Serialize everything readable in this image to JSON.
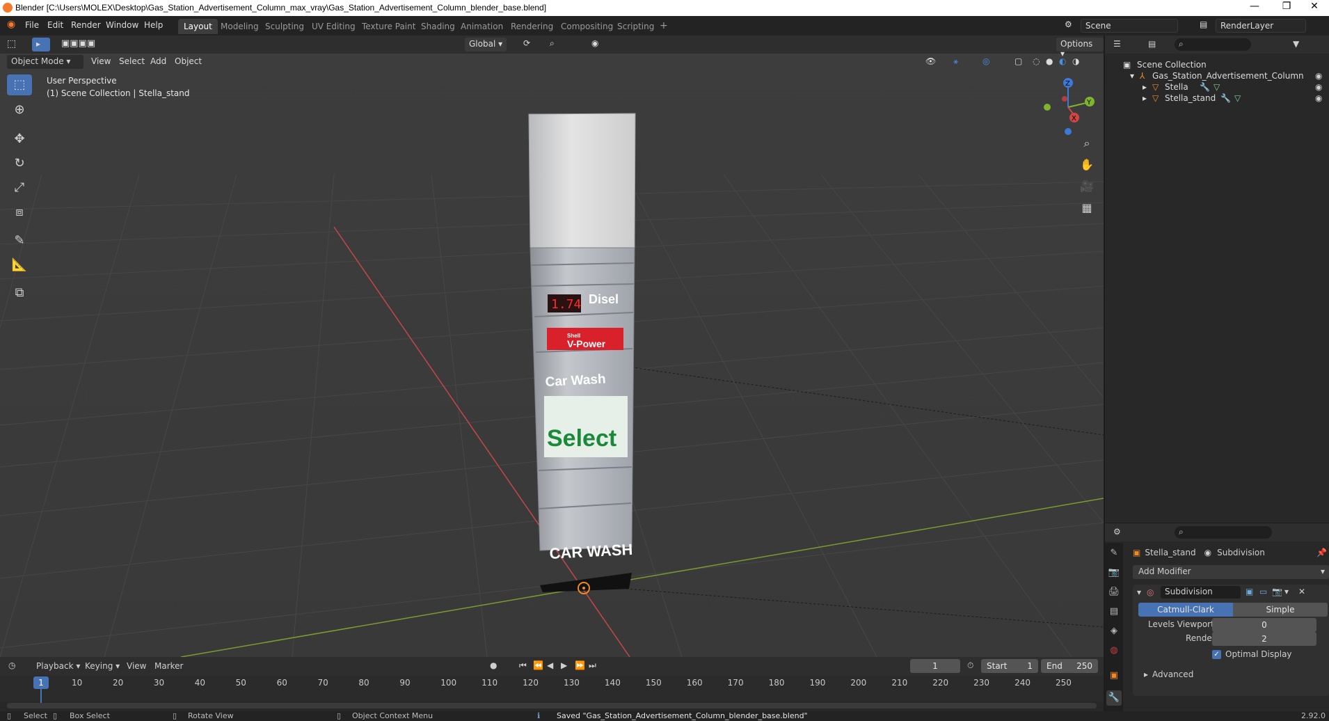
{
  "window": {
    "title": "Blender [C:\\Users\\MOLEX\\Desktop\\Gas_Station_Advertisement_Column_max_vray\\Gas_Station_Advertisement_Column_blender_base.blend]",
    "minimize": "—",
    "restore": "❐",
    "close": "✕"
  },
  "menu": [
    "File",
    "Edit",
    "Render",
    "Window",
    "Help"
  ],
  "workspaces": [
    "Layout",
    "Modeling",
    "Sculpting",
    "UV Editing",
    "Texture Paint",
    "Shading",
    "Animation",
    "Rendering",
    "Compositing",
    "Scripting"
  ],
  "active_workspace": "Layout",
  "scene": {
    "name": "Scene",
    "view_layer": "RenderLayer"
  },
  "viewport": {
    "transform_orientation": "Global",
    "options_label": "Options",
    "mode": "Object Mode",
    "header_menus": [
      "View",
      "Select",
      "Add",
      "Object"
    ],
    "info_line1": "User Perspective",
    "info_line2": "(1) Scene Collection | Stella_stand",
    "tools": [
      "select-box-icon",
      "cursor-icon",
      "move-icon",
      "rotate-icon",
      "scale-icon",
      "transform-icon",
      "annotate-icon",
      "measure-icon",
      "add-cube-icon"
    ],
    "gizmo_axes": {
      "z": "Z",
      "y": "Y",
      "x": "X"
    },
    "model_labels": {
      "price": "1.74",
      "fuel": "Disel",
      "brand_small": "Shell",
      "brand": "V-Power",
      "carwash1": "Car Wash",
      "select": "Select",
      "carwash2": "CAR WASH"
    }
  },
  "outliner": {
    "root": "Scene Collection",
    "collection": "Gas_Station_Advertisement_Column",
    "objects": [
      "Stella",
      "Stella_stand"
    ]
  },
  "properties": {
    "object": "Stella_stand",
    "modifier_context": "Subdivision",
    "add_modifier": "Add Modifier",
    "modifier_name": "Subdivision",
    "modes": [
      "Catmull-Clark",
      "Simple"
    ],
    "active_mode": "Catmull-Clark",
    "levels_viewport_label": "Levels Viewport",
    "levels_viewport": "0",
    "render_label": "Render",
    "render": "2",
    "optimal_display_label": "Optimal Display",
    "optimal_display": true,
    "advanced_label": "Advanced"
  },
  "timeline": {
    "menus": [
      "Playback",
      "Keying",
      "View",
      "Marker"
    ],
    "current_frame": "1",
    "start_label": "Start",
    "start": "1",
    "end_label": "End",
    "end": "250",
    "ticks": [
      "1",
      "10",
      "20",
      "30",
      "40",
      "50",
      "60",
      "70",
      "80",
      "90",
      "100",
      "110",
      "120",
      "130",
      "140",
      "150",
      "160",
      "170",
      "180",
      "190",
      "200",
      "210",
      "220",
      "230",
      "240",
      "250"
    ]
  },
  "status": {
    "select": "Select",
    "box_select": "Box Select",
    "rotate_view": "Rotate View",
    "context_menu": "Object Context Menu",
    "message": "Saved \"Gas_Station_Advertisement_Column_blender_base.blend\"",
    "version": "2.92.0"
  },
  "colors": {
    "accent": "#4772b3",
    "viewport_bg": "#3c3c3c",
    "axis_x": "#d14545",
    "axis_y": "#7fb52d",
    "axis_z": "#3b7ad8",
    "orange_object": "#f08a24"
  }
}
